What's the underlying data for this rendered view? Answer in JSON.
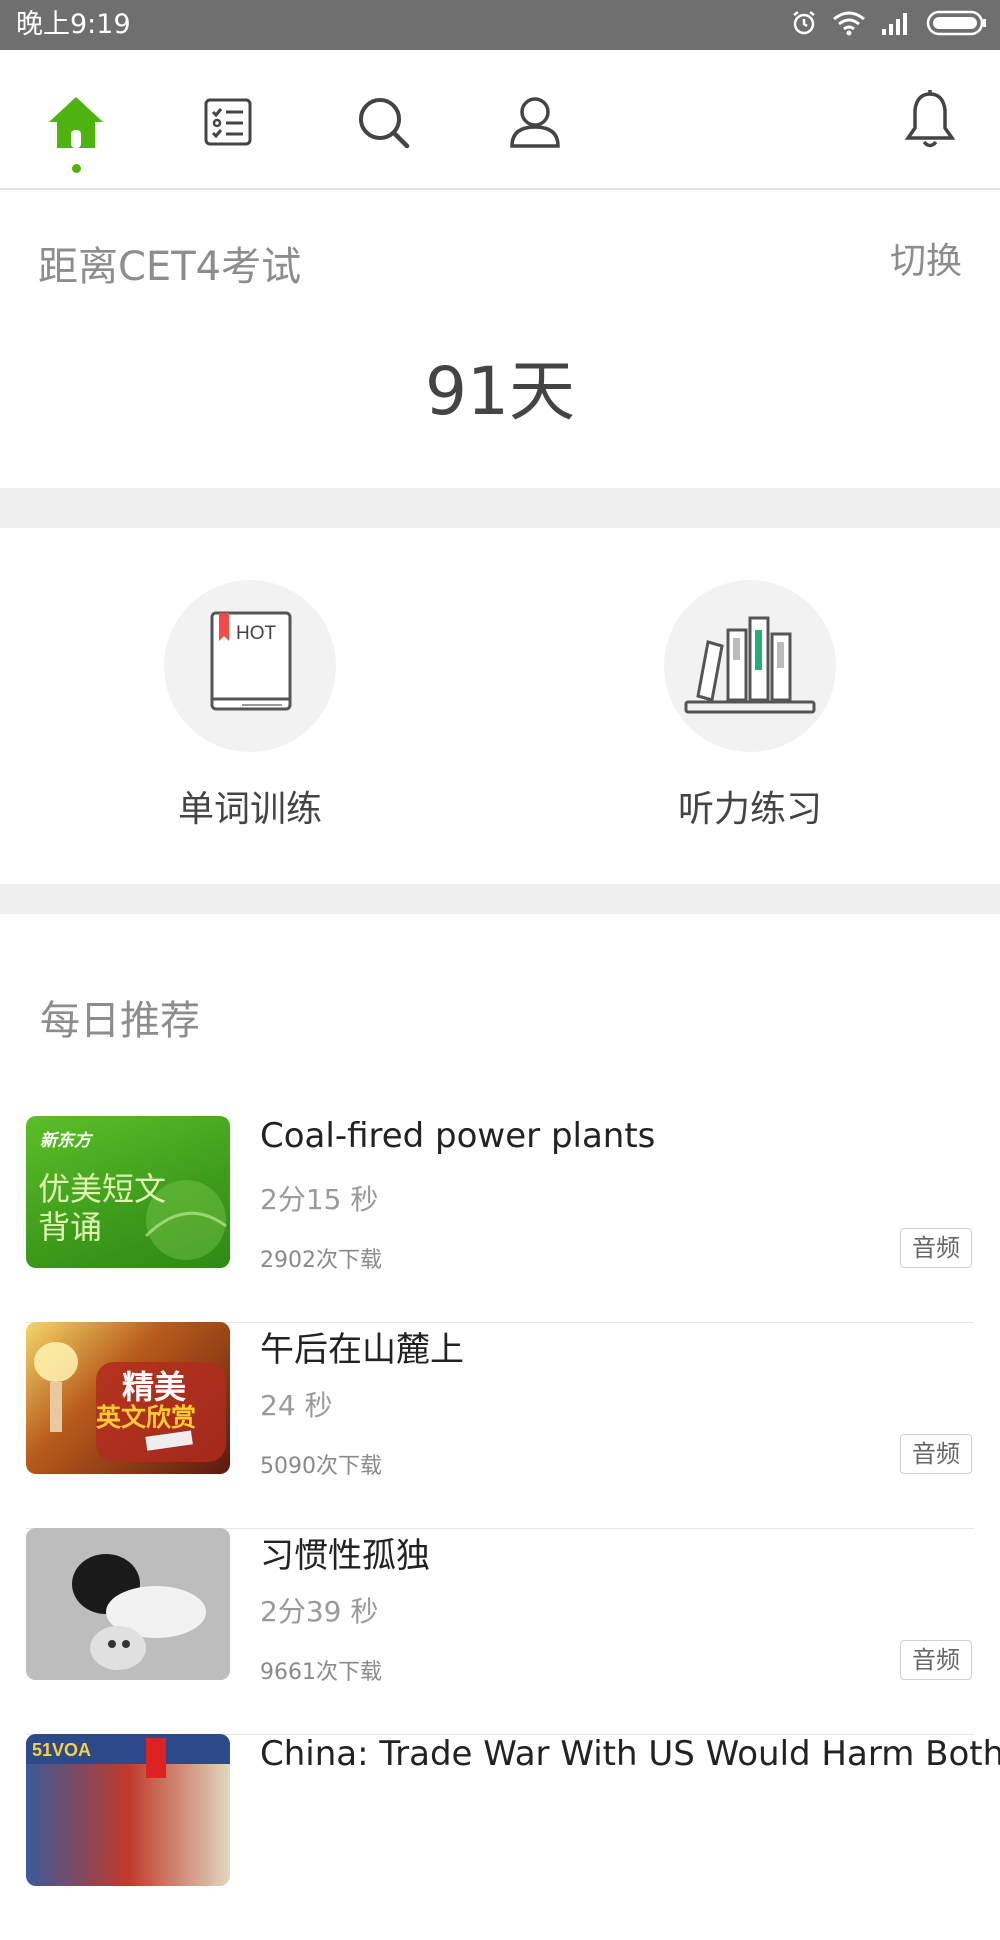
{
  "status_bar": {
    "time": "晚上9:19",
    "icons": [
      "alarm-icon",
      "wifi-icon",
      "signal-icon",
      "battery-icon"
    ]
  },
  "nav": {
    "items": [
      {
        "name": "home",
        "icon": "home-icon",
        "active": true
      },
      {
        "name": "tasks",
        "icon": "checklist-icon"
      },
      {
        "name": "search",
        "icon": "search-icon"
      },
      {
        "name": "profile",
        "icon": "user-icon"
      },
      {
        "name": "notifications",
        "icon": "bell-icon"
      }
    ],
    "accent_color": "#4fb30f"
  },
  "countdown": {
    "label": "距离CET4考试",
    "switch": "切换",
    "days": "91天"
  },
  "features": [
    {
      "label": "单词训练",
      "icon": "hot-book-icon",
      "badge": "HOT"
    },
    {
      "label": "听力练习",
      "icon": "bookshelf-icon"
    }
  ],
  "daily": {
    "title": "每日推荐",
    "items": [
      {
        "title": "Coal-fired power plants",
        "duration": "2分15 秒",
        "downloads": "2902次下载",
        "badge": "音频",
        "thumb_text": [
          "新东方",
          "优美短文",
          "背诵"
        ]
      },
      {
        "title": "午后在山麓上",
        "duration": "24 秒",
        "downloads": "5090次下载",
        "badge": "音频",
        "thumb_text": [
          "精美",
          "英文欣赏"
        ]
      },
      {
        "title": "习惯性孤独",
        "duration": "2分39 秒",
        "downloads": "9661次下载",
        "badge": "音频"
      },
      {
        "title": "China: Trade War With US Would Harm Both",
        "thumb_text": [
          "51VOA"
        ]
      }
    ]
  }
}
